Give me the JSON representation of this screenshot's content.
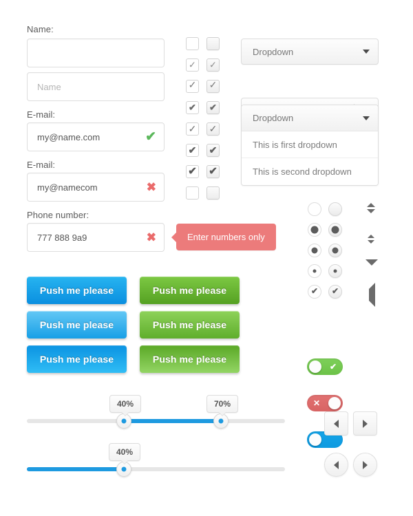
{
  "form": {
    "name_label": "Name:",
    "name_value": "",
    "name_placeholder": "",
    "name2_value": "",
    "name2_placeholder": "Name",
    "email_label_1": "E-mail:",
    "email_valid_value": "my@name.com",
    "email_valid_icon": "check-icon",
    "email_label_2": "E-mail:",
    "email_invalid_value": "my@namecom",
    "email_invalid_icon": "cross-icon",
    "phone_label": "Phone number:",
    "phone_value": "777 888 9a9",
    "phone_icon": "cross-icon",
    "tooltip_text": "Enter numbers only"
  },
  "checkboxes": {
    "rows": [
      {
        "plain_state": "unchecked",
        "shaded_state": "unchecked",
        "tick": ""
      },
      {
        "plain_state": "checked",
        "shaded_state": "checked",
        "tick": "✓"
      },
      {
        "plain_state": "checked",
        "shaded_state": "checked",
        "tick": "✓"
      },
      {
        "plain_state": "checked",
        "shaded_state": "checked",
        "tick": "✔"
      },
      {
        "plain_state": "checked",
        "shaded_state": "checked",
        "tick": "✓"
      },
      {
        "plain_state": "checked",
        "shaded_state": "checked",
        "tick": "✔"
      },
      {
        "plain_state": "checked",
        "shaded_state": "checked",
        "tick": "✔"
      },
      {
        "plain_state": "unchecked",
        "shaded_state": "unchecked",
        "tick": ""
      }
    ]
  },
  "dropdowns": {
    "simple_label": "Dropdown",
    "separated_label": "Dropdown",
    "open_label": "Dropdown",
    "open_options": [
      "This is first dropdown",
      "This is second dropdown"
    ],
    "caret_icon": "chevron-down-icon"
  },
  "radios": {
    "rows": [
      {
        "state": "empty",
        "dot": ""
      },
      {
        "state": "filled-big",
        "dot": "●"
      },
      {
        "state": "filled-mid",
        "dot": "●"
      },
      {
        "state": "filled-small",
        "dot": "●"
      },
      {
        "state": "checkmark",
        "dot": "✔"
      }
    ]
  },
  "switches": [
    {
      "name": "toggle-on-green",
      "state": "on",
      "color": "#6cc247",
      "mark": "✔"
    },
    {
      "name": "toggle-off-red",
      "state": "off",
      "color": "#d86464",
      "mark": "✕"
    },
    {
      "name": "toggle-on-blue",
      "state": "on",
      "color": "#0d9ae0",
      "mark": ""
    }
  ],
  "spinners": [
    {
      "name": "spinner-large",
      "icon": "up-down-arrows-icon"
    },
    {
      "name": "spinner-small",
      "icon": "up-down-arrows-icon"
    },
    {
      "name": "caret-down-large",
      "icon": "triangle-down-icon"
    },
    {
      "name": "caret-left-large",
      "icon": "triangle-left-icon"
    }
  ],
  "buttons": {
    "label": "Push me please",
    "variants": [
      {
        "name": "blue-button-1",
        "accent": "#0a8fe0"
      },
      {
        "name": "blue-button-2",
        "accent": "#18a0e6"
      },
      {
        "name": "blue-button-3",
        "accent": "#0b93e2"
      },
      {
        "name": "green-button-1",
        "accent": "#55a122"
      },
      {
        "name": "green-button-2",
        "accent": "#5fae2c"
      },
      {
        "name": "green-button-3",
        "accent": "#5aa826"
      }
    ]
  },
  "sliders": {
    "range": {
      "name": "range-slider",
      "min_label": "40%",
      "max_label": "70%",
      "min_value": 40,
      "max_value": 70
    },
    "single": {
      "name": "single-slider",
      "label": "40%",
      "value": 40
    },
    "track_color": "#e6e6e6",
    "fill_color": "#1e9ae0"
  },
  "nav_buttons": {
    "square": [
      {
        "name": "prev-square-button",
        "icon": "triangle-left-icon"
      },
      {
        "name": "next-square-button",
        "icon": "triangle-right-icon"
      }
    ],
    "round": [
      {
        "name": "prev-round-button",
        "icon": "triangle-left-icon"
      },
      {
        "name": "next-round-button",
        "icon": "triangle-right-icon"
      }
    ]
  }
}
